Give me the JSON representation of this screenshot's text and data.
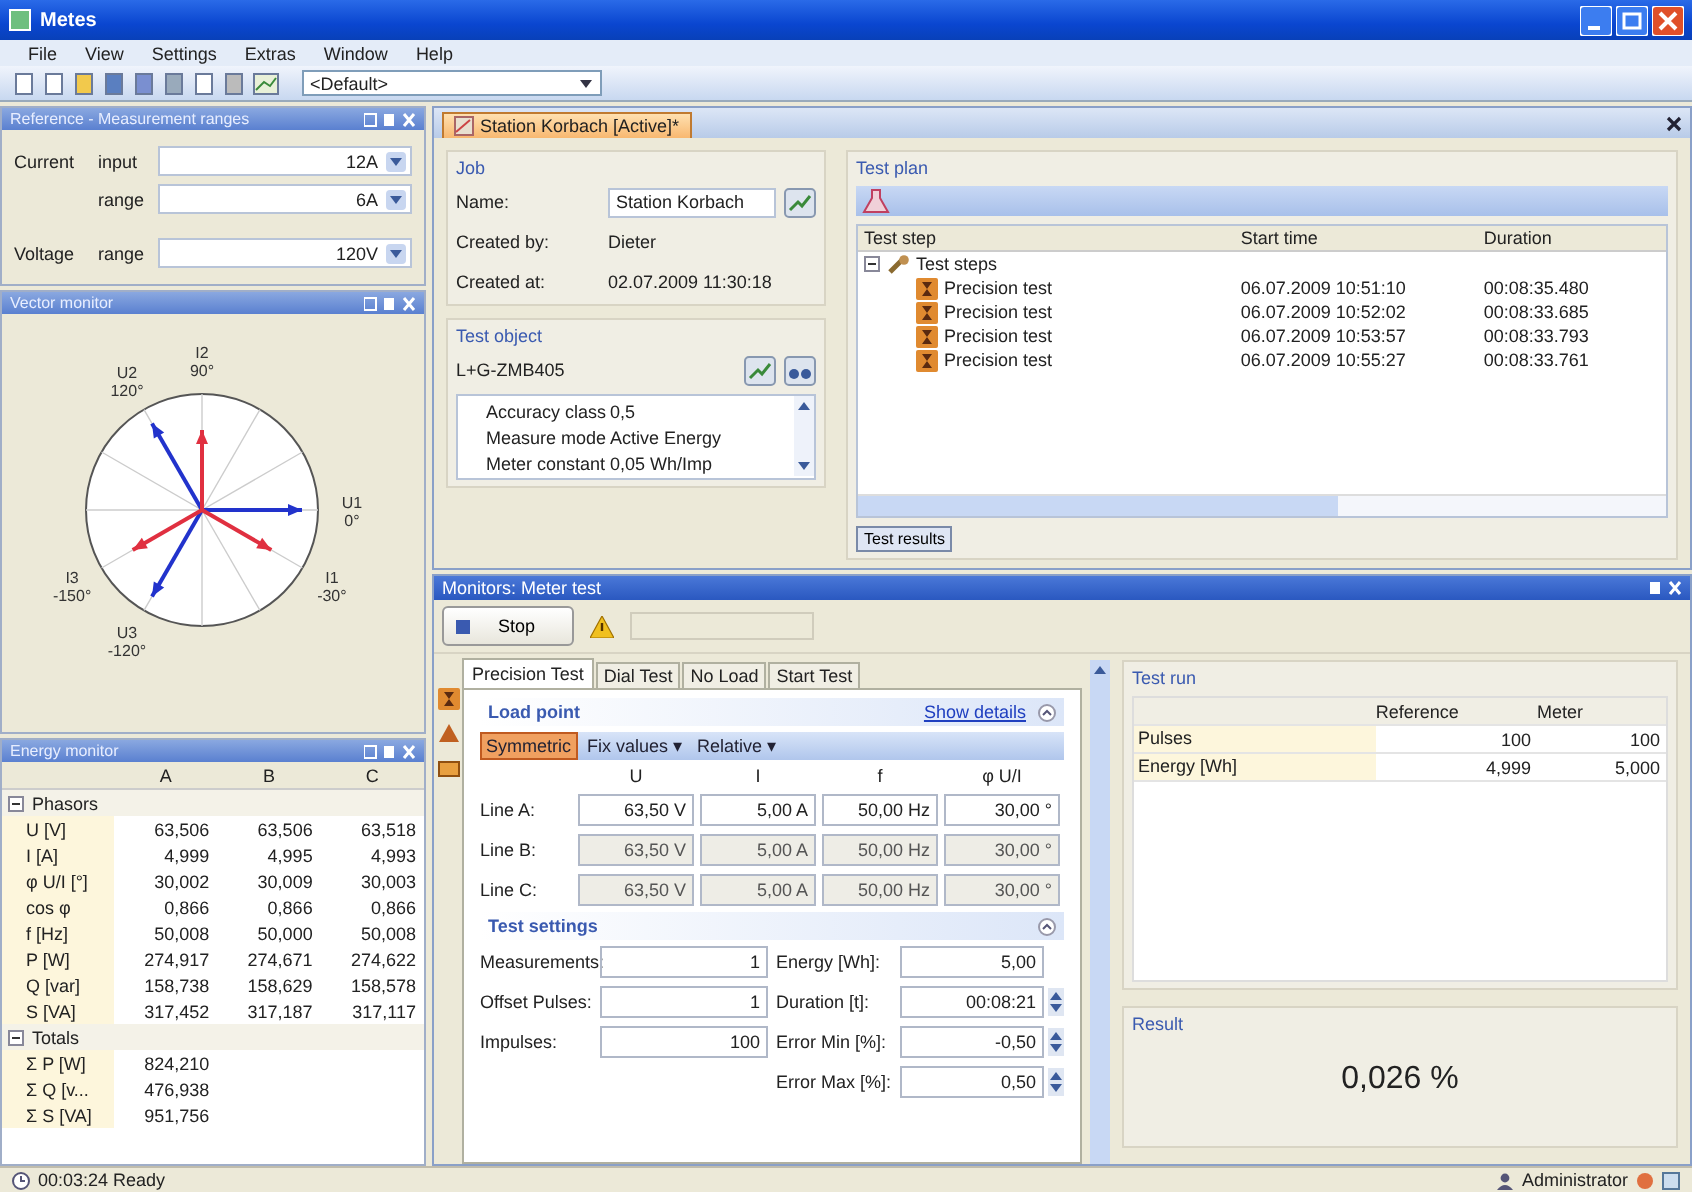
{
  "window": {
    "title": "Metes"
  },
  "menu": [
    "File",
    "View",
    "Settings",
    "Extras",
    "Window",
    "Help"
  ],
  "toolbar": {
    "profile": "<Default>"
  },
  "reference_panel": {
    "title": "Reference - Measurement ranges",
    "rows": [
      {
        "group": "Current",
        "label": "input",
        "value": "12A"
      },
      {
        "label": "range",
        "value": "6A"
      },
      {
        "group": "Voltage",
        "label": "range",
        "value": "120V"
      }
    ]
  },
  "vector_panel": {
    "title": "Vector monitor",
    "phasors": [
      {
        "kind": "voltage",
        "name": "U1",
        "angle": "0°"
      },
      {
        "kind": "voltage",
        "name": "U2",
        "angle": "120°"
      },
      {
        "kind": "voltage",
        "name": "U3",
        "angle": "-120°"
      },
      {
        "kind": "current",
        "name": "I1",
        "angle": "-30°"
      },
      {
        "kind": "current",
        "name": "I2",
        "angle": "90°"
      },
      {
        "kind": "current",
        "name": "I3",
        "angle": "-150°"
      }
    ]
  },
  "energy_panel": {
    "title": "Energy monitor",
    "columns": [
      "A",
      "B",
      "C"
    ],
    "groups": [
      {
        "name": "Phasors",
        "expanded": true,
        "rows": [
          {
            "label": "U [V]",
            "values": [
              "63,506",
              "63,506",
              "63,518"
            ]
          },
          {
            "label": "I [A]",
            "values": [
              "4,999",
              "4,995",
              "4,993"
            ]
          },
          {
            "label": "φ U/I [°]",
            "values": [
              "30,002",
              "30,009",
              "30,003"
            ]
          },
          {
            "label": "cos φ",
            "values": [
              "0,866",
              "0,866",
              "0,866"
            ]
          },
          {
            "label": "f [Hz]",
            "values": [
              "50,008",
              "50,000",
              "50,008"
            ]
          },
          {
            "label": "P [W]",
            "values": [
              "274,917",
              "274,671",
              "274,622"
            ]
          },
          {
            "label": "Q [var]",
            "values": [
              "158,738",
              "158,629",
              "158,578"
            ]
          },
          {
            "label": "S [VA]",
            "values": [
              "317,452",
              "317,187",
              "317,117"
            ]
          }
        ]
      },
      {
        "name": "Totals",
        "expanded": true,
        "rows": [
          {
            "label": "Σ P [W]",
            "values": [
              "824,210"
            ]
          },
          {
            "label": "Σ Q [v...",
            "values": [
              "476,938"
            ]
          },
          {
            "label": "Σ S [VA]",
            "values": [
              "951,756"
            ]
          }
        ]
      }
    ]
  },
  "document": {
    "tab": "Station Korbach [Active]*",
    "job": {
      "title": "Job",
      "fields": [
        {
          "label": "Name:",
          "value": "Station Korbach",
          "kind": "input"
        },
        {
          "label": "Created by:",
          "value": "Dieter",
          "kind": "text"
        },
        {
          "label": "Created at:",
          "value": "02.07.2009 11:30:18",
          "kind": "text"
        }
      ]
    },
    "test_object": {
      "title": "Test object",
      "meter": "L+G-ZMB405",
      "properties": [
        {
          "name": "Accuracy class",
          "value": "0,5"
        },
        {
          "name": "Measure mode",
          "value": "Active Energy"
        },
        {
          "name": "Meter constant",
          "value": "0,05 Wh/Imp"
        }
      ]
    },
    "test_plan": {
      "title": "Test plan",
      "columns": [
        "Test step",
        "Start time",
        "Duration"
      ],
      "root": {
        "label": "Test steps",
        "expanded": true,
        "children": [
          {
            "label": "Precision test",
            "start": "06.07.2009 10:51:10",
            "duration": "00:08:35.480"
          },
          {
            "label": "Precision test",
            "start": "06.07.2009 10:52:02",
            "duration": "00:08:33.685"
          },
          {
            "label": "Precision test",
            "start": "06.07.2009 10:53:57",
            "duration": "00:08:33.793"
          },
          {
            "label": "Precision test",
            "start": "06.07.2009 10:55:27",
            "duration": "00:08:33.761"
          }
        ]
      }
    },
    "results_button": "Test results"
  },
  "monitor": {
    "title": "Monitors: Meter test",
    "stop_button": "Stop",
    "tabs": [
      {
        "label": "Precision Test",
        "selected": true
      },
      {
        "label": "Dial Test",
        "selected": false
      },
      {
        "label": "No Load",
        "selected": false
      },
      {
        "label": "Start Test",
        "selected": false
      }
    ],
    "load_point": {
      "title": "Load point",
      "details_link": "Show details",
      "modes": [
        {
          "label": "Symmetric",
          "selected": true
        },
        {
          "label": "Fix values ▾",
          "selected": false
        },
        {
          "label": "Relative ▾",
          "selected": false
        }
      ],
      "columns": [
        "U",
        "I",
        "f",
        "φ U/I"
      ],
      "lines": [
        {
          "label": "Line A:",
          "editable": true,
          "values": [
            "63,50 V",
            "5,00 A",
            "50,00 Hz",
            "30,00 °"
          ]
        },
        {
          "label": "Line B:",
          "editable": false,
          "values": [
            "63,50 V",
            "5,00 A",
            "50,00 Hz",
            "30,00 °"
          ]
        },
        {
          "label": "Line C:",
          "editable": false,
          "values": [
            "63,50 V",
            "5,00 A",
            "50,00 Hz",
            "30,00 °"
          ]
        }
      ]
    },
    "test_settings": {
      "title": "Test settings",
      "left_fields": [
        {
          "label": "Measurements:",
          "value": "1",
          "spin": false
        },
        {
          "label": "Offset Pulses:",
          "value": "1",
          "spin": false
        },
        {
          "label": "Impulses:",
          "value": "100",
          "spin": false
        }
      ],
      "right_fields": [
        {
          "label": "Energy [Wh]:",
          "value": "5,00",
          "spin": false
        },
        {
          "label": "Duration [t]:",
          "value": "00:08:21",
          "spin": true
        },
        {
          "label": "Error Min [%]:",
          "value": "-0,50",
          "spin": true
        },
        {
          "label": "Error Max [%]:",
          "value": "0,50",
          "spin": true
        }
      ]
    },
    "test_run": {
      "title": "Test run",
      "columns": [
        "Reference",
        "Meter"
      ],
      "rows": [
        {
          "label": "Pulses",
          "values": [
            "100",
            "100"
          ]
        },
        {
          "label": "Energy [Wh]",
          "values": [
            "4,999",
            "5,000"
          ]
        }
      ]
    },
    "result": {
      "title": "Result",
      "value": "0,026 %"
    }
  },
  "status_bar": {
    "message": "00:03:24 Ready",
    "user": "Administrator"
  }
}
